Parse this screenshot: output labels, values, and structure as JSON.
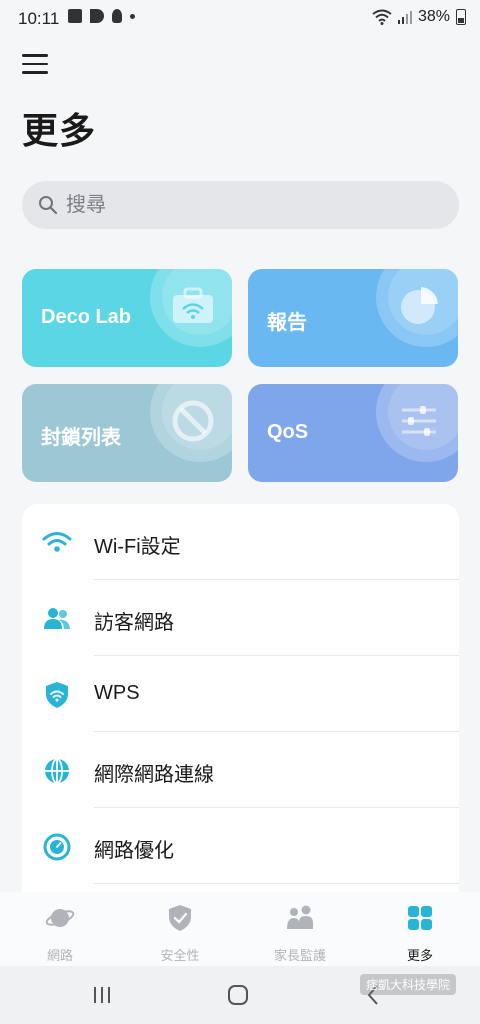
{
  "status_bar": {
    "time": "10:11",
    "battery": "38%"
  },
  "header": {
    "title": "更多"
  },
  "search": {
    "placeholder": "搜尋"
  },
  "tiles": [
    {
      "label": "Deco Lab",
      "color": "#5bd6e4",
      "icon": "briefcase-wifi-icon"
    },
    {
      "label": "報告",
      "color": "#6ab8f2",
      "icon": "pie-chart-icon"
    },
    {
      "label": "封鎖列表",
      "color": "#9cc8d6",
      "icon": "block-icon"
    },
    {
      "label": "QoS",
      "color": "#7fa6ea",
      "icon": "sliders-icon"
    }
  ],
  "menu": {
    "items": [
      {
        "label": "Wi-Fi設定",
        "icon": "wifi-icon"
      },
      {
        "label": "訪客網路",
        "icon": "guests-icon"
      },
      {
        "label": "WPS",
        "icon": "wps-shield-icon"
      },
      {
        "label": "網際網路連線",
        "icon": "globe-icon"
      },
      {
        "label": "網路優化",
        "icon": "optimize-icon"
      }
    ]
  },
  "bottom_nav": {
    "items": [
      {
        "label": "網路",
        "icon": "planet-icon",
        "active": false
      },
      {
        "label": "安全性",
        "icon": "shield-check-icon",
        "active": false
      },
      {
        "label": "家長監護",
        "icon": "family-icon",
        "active": false
      },
      {
        "label": "更多",
        "icon": "grid-icon",
        "active": true
      }
    ]
  },
  "colors": {
    "accent": "#27b4d6",
    "inactive": "#b0b4ba"
  },
  "watermark": "痞凱大科技學院"
}
